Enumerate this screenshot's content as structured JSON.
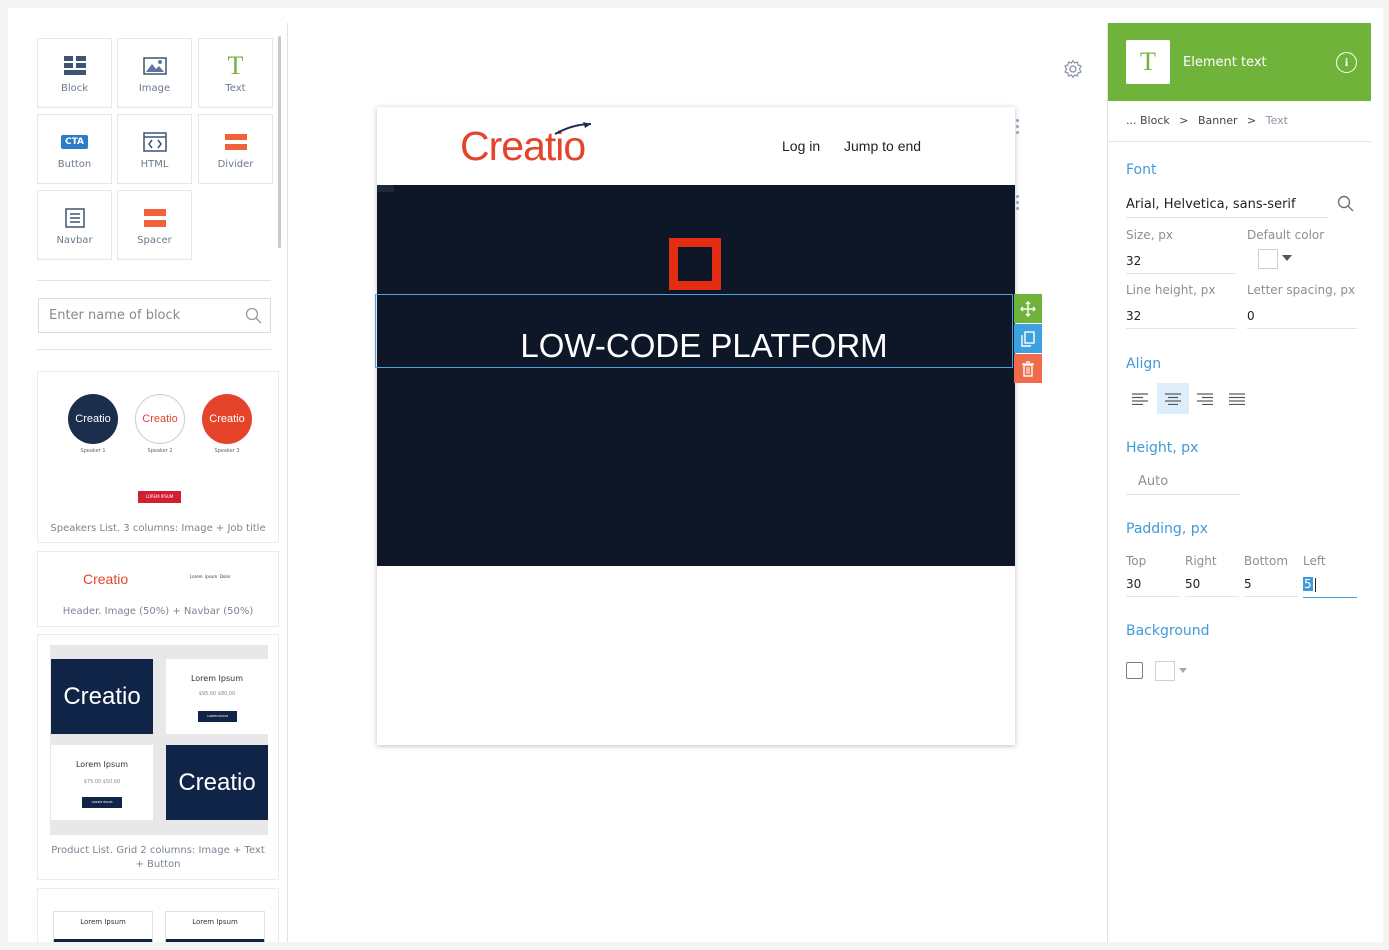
{
  "left_panel": {
    "tiles": [
      {
        "label": "Block",
        "icon": "block-icon"
      },
      {
        "label": "Image",
        "icon": "image-icon"
      },
      {
        "label": "Text",
        "icon": "text-icon"
      },
      {
        "label": "Button",
        "icon": "cta-button-icon",
        "badge": "CTA"
      },
      {
        "label": "HTML",
        "icon": "html-icon"
      },
      {
        "label": "Divider",
        "icon": "divider-icon"
      },
      {
        "label": "Navbar",
        "icon": "navbar-icon"
      },
      {
        "label": "Spacer",
        "icon": "spacer-icon"
      }
    ],
    "search": {
      "placeholder": "Enter name of block"
    },
    "templates": [
      {
        "caption": "Speakers List. 3 columns: Image + Job title",
        "speakers": [
          "Speaker 1",
          "Speaker 2",
          "Speaker 3"
        ],
        "logo": "Creatio",
        "button": "LOREM IPSUM"
      },
      {
        "caption": "Header. Image (50%) + Navbar (50%)",
        "logo": "Creatio",
        "nav": "Lorem  Ipsum  Dolor"
      },
      {
        "caption": "Product List. Grid 2 columns: Image + Text + Button",
        "logo": "Creatio",
        "product_title": "Lorem Ipsum",
        "price_1": "$95.00 $80.00",
        "price_2": "$75.00 $50.00",
        "button": "LOREM IPSUM"
      },
      {
        "item_1": "Lorem Ipsum",
        "item_2": "Lorem Ipsum"
      }
    ]
  },
  "canvas": {
    "email": {
      "logo": "Creatio",
      "nav_login": "Log in",
      "nav_jump": "Jump to end",
      "headline": "LOW-CODE PLATFORM"
    }
  },
  "right_panel": {
    "title": "Element text",
    "icon_letter": "T",
    "breadcrumb": {
      "prefix": "... Block",
      "sep": ">",
      "middle": "Banner",
      "current": "Text"
    },
    "font": {
      "section": "Font",
      "family": "Arial, Helvetica, sans-serif",
      "size_label": "Size, px",
      "size": "32",
      "color_label": "Default color",
      "line_height_label": "Line height, px",
      "line_height": "32",
      "letter_spacing_label": "Letter spacing, px",
      "letter_spacing": "0"
    },
    "align": {
      "section": "Align",
      "selected": "center"
    },
    "height": {
      "section": "Height, px",
      "value": "Auto"
    },
    "padding": {
      "section": "Padding, px",
      "top_label": "Top",
      "top": "30",
      "right_label": "Right",
      "right": "50",
      "bottom_label": "Bottom",
      "bottom": "5",
      "left_label": "Left",
      "left": "5"
    },
    "background": {
      "section": "Background"
    }
  },
  "colors": {
    "accent_green": "#6fb33b",
    "link_blue": "#3e9bd6",
    "brand_red": "#e5442b",
    "banner_navy": "#0e1728"
  }
}
